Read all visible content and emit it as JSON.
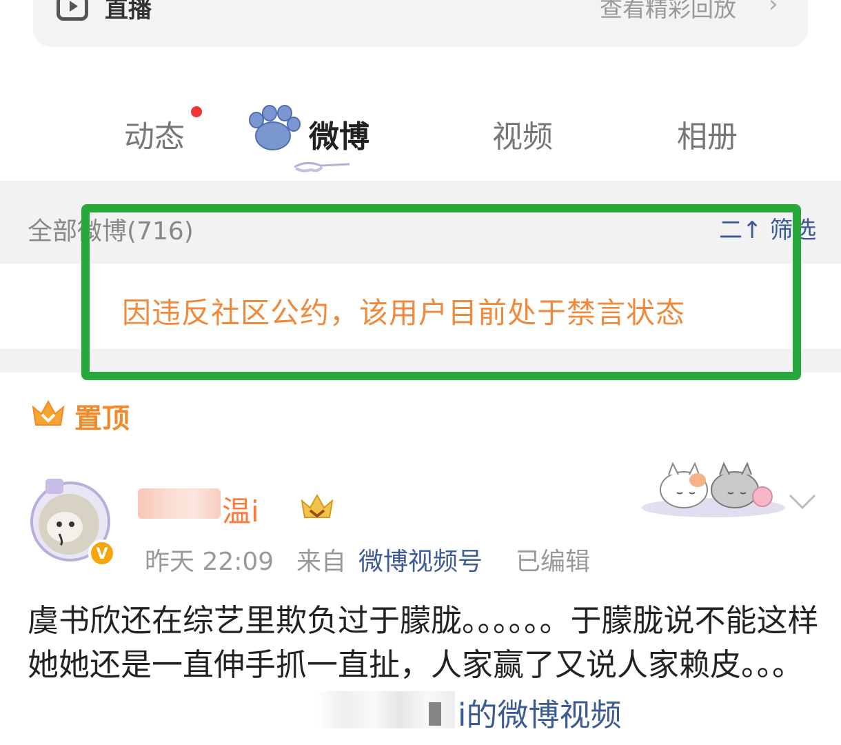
{
  "live": {
    "title": "直播",
    "replay": "查看精彩回放",
    "chevron": "›"
  },
  "tabs": [
    {
      "label": "动态"
    },
    {
      "label": "微博"
    },
    {
      "label": "视频"
    },
    {
      "label": "相册"
    }
  ],
  "feed": {
    "all_count": "全部微博(716)",
    "filter": "筛选",
    "filter_icon": "二↑"
  },
  "notice": "因违反社区公约，该用户目前处于禁言状态",
  "pinned": {
    "label": "置顶"
  },
  "post": {
    "name": "温i",
    "time": "昨天 22:09",
    "from": "来自",
    "source": "微博视频号",
    "edited": "已编辑",
    "text": "虞书欣还在综艺里欺负过于朦胧。。。。。。于朦胧说不能这样她她还是一直伸手抓一直扯，人家赢了又说人家赖皮。。。",
    "video_link": "i的微博视频"
  },
  "colors": {
    "accent": "#ef8a3c",
    "link": "#3d5b93",
    "highlight_box": "#28a83a",
    "badge_red": "#f2333a"
  }
}
